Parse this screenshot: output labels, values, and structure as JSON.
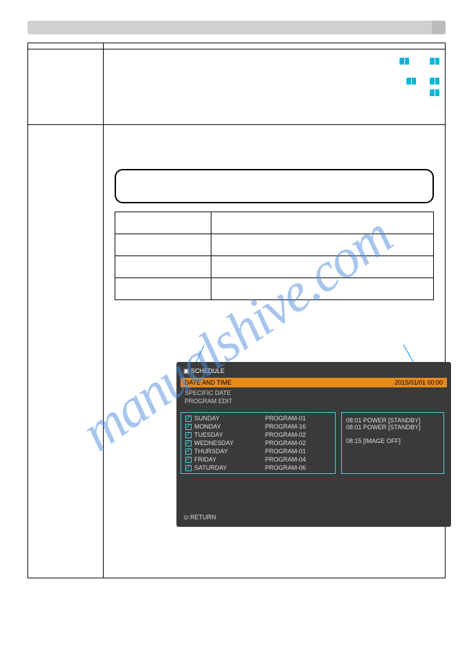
{
  "watermark": "manualshive.com",
  "screenshot": {
    "title": "SCHEDULE",
    "orange_label": "DATE AND TIME",
    "orange_value": "2015/01/01 00:00",
    "tabs": [
      "SPECIFIC DATE",
      "PROGRAM EDIT"
    ],
    "days": [
      {
        "day": "SUNDAY",
        "program": "PROGRAM-01"
      },
      {
        "day": "MONDAY",
        "program": "PROGRAM-16"
      },
      {
        "day": "TUESDAY",
        "program": "PROGRAM-02"
      },
      {
        "day": "WEDNESDAY",
        "program": "PROGRAM-02"
      },
      {
        "day": "THURSDAY",
        "program": "PROGRAM-01"
      },
      {
        "day": "FRIDAY",
        "program": "PROGRAM-04"
      },
      {
        "day": "SATURDAY",
        "program": "PROGRAM-06"
      }
    ],
    "events": [
      "08:01 POWER [STANDBY]",
      "08:01 POWER [STANDBY]",
      "",
      "08:15 [IMAGE OFF]"
    ],
    "return": "⊙:RETURN"
  }
}
